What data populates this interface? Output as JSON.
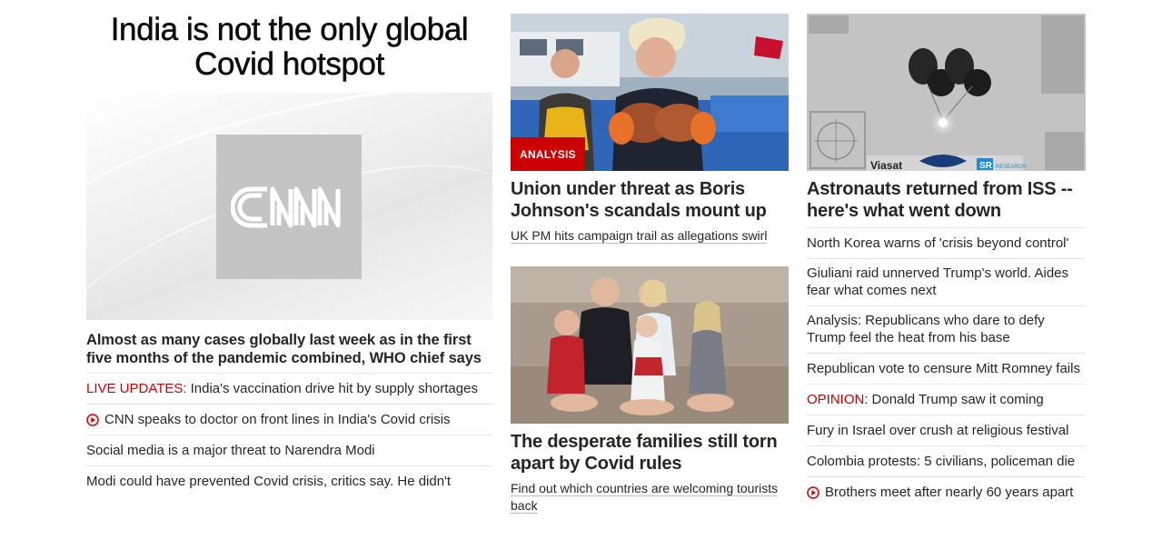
{
  "lead": {
    "title": "India is not the only global Covid hotspot",
    "headline": "Almost as many cases globally last week as in the first five months of the pandemic combined, WHO chief says",
    "links": [
      {
        "kicker": "LIVE UPDATES:",
        "text": "India's vaccination drive hit by supply shortages",
        "icon": ""
      },
      {
        "kicker": "",
        "text": "CNN speaks to doctor on front lines in India's Covid crisis",
        "icon": "play-icon"
      },
      {
        "kicker": "",
        "text": "Social media is a major threat to Narendra Modi",
        "icon": ""
      },
      {
        "kicker": "",
        "text": "Modi could have prevented Covid crisis, critics say. He didn't",
        "icon": ""
      }
    ]
  },
  "middle": {
    "card1": {
      "badge": "ANALYSIS",
      "headline": "Union under threat as Boris Johnson's scandals mount up",
      "sub": "UK PM hits campaign trail as allegations swirl"
    },
    "card2": {
      "headline": "The desperate families still torn apart by Covid rules",
      "sub": "Find out which countries are welcoming tourists back"
    }
  },
  "right": {
    "headline": "Astronauts returned from ISS -- here's what went down",
    "image_text": {
      "viasat": "Viasat",
      "sr": "SR",
      "research": "RESEARCH"
    },
    "links": [
      {
        "kicker": "",
        "text": "North Korea warns of 'crisis beyond control'",
        "icon": ""
      },
      {
        "kicker": "",
        "text": "Giuliani raid unnerved Trump's world. Aides fear what comes next",
        "icon": ""
      },
      {
        "kicker": "",
        "text": "Analysis: Republicans who dare to defy Trump feel the heat from his base",
        "icon": ""
      },
      {
        "kicker": "",
        "text": "Republican vote to censure Mitt Romney fails",
        "icon": ""
      },
      {
        "kicker": "OPINION:",
        "text": "Donald Trump saw it coming",
        "icon": ""
      },
      {
        "kicker": "",
        "text": "Fury in Israel over crush at religious festival",
        "icon": ""
      },
      {
        "kicker": "",
        "text": "Colombia protests: 5 civilians, policeman die",
        "icon": ""
      },
      {
        "kicker": "",
        "text": "Brothers meet after nearly 60 years apart",
        "icon": "play-icon"
      }
    ]
  },
  "colors": {
    "accent": "#cc0000",
    "text": "#262626",
    "divider": "#e4e4e4",
    "placeholder": "#c4c4c4"
  }
}
